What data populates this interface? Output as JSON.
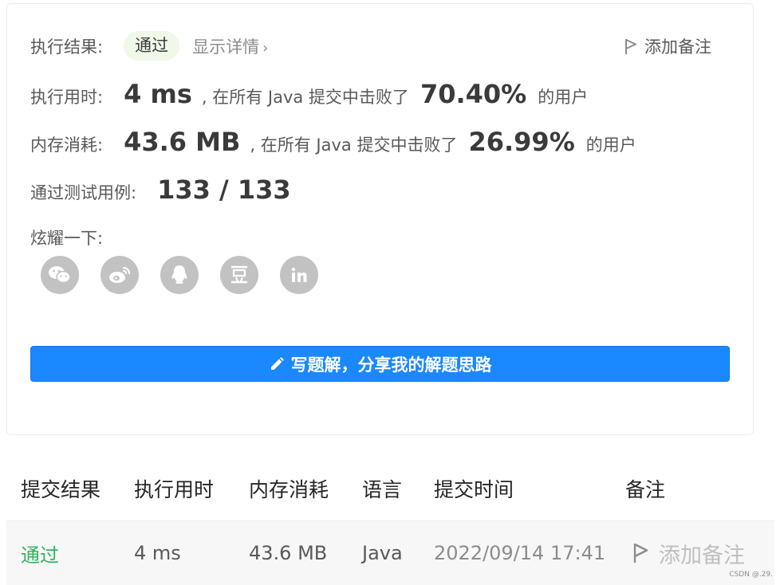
{
  "result": {
    "label": "执行结果:",
    "status": "通过",
    "details_link": "显示详情",
    "details_chevron": "›",
    "add_note": "添加备注"
  },
  "runtime": {
    "label": "执行用时:",
    "value": "4 ms",
    "text_before": ", 在所有 Java 提交中击败了",
    "percent": "70.40%",
    "text_after": "的用户"
  },
  "memory": {
    "label": "内存消耗:",
    "value": "43.6 MB",
    "text_before": ", 在所有 Java 提交中击败了",
    "percent": "26.99%",
    "text_after": "的用户"
  },
  "testcases": {
    "label": "通过测试用例:",
    "value": "133 / 133"
  },
  "share": {
    "label": "炫耀一下:",
    "icons": [
      "wechat-icon",
      "weibo-icon",
      "qq-icon",
      "douban-icon",
      "linkedin-icon"
    ]
  },
  "write_solution_button": "写题解，分享我的解题思路",
  "submissions": {
    "headers": [
      "提交结果",
      "执行用时",
      "内存消耗",
      "语言",
      "提交时间",
      "备注"
    ],
    "rows": [
      {
        "result": "通过",
        "runtime": "4 ms",
        "memory": "43.6 MB",
        "language": "Java",
        "time": "2022/09/14 17:41",
        "note": "添加备注"
      }
    ]
  },
  "watermark": "CSDN @.29.",
  "colors": {
    "accent_blue": "#1a88ff",
    "pass_green": "#2db55d",
    "badge_bg": "#f0f8ea",
    "icon_gray": "#c2c2c2"
  }
}
